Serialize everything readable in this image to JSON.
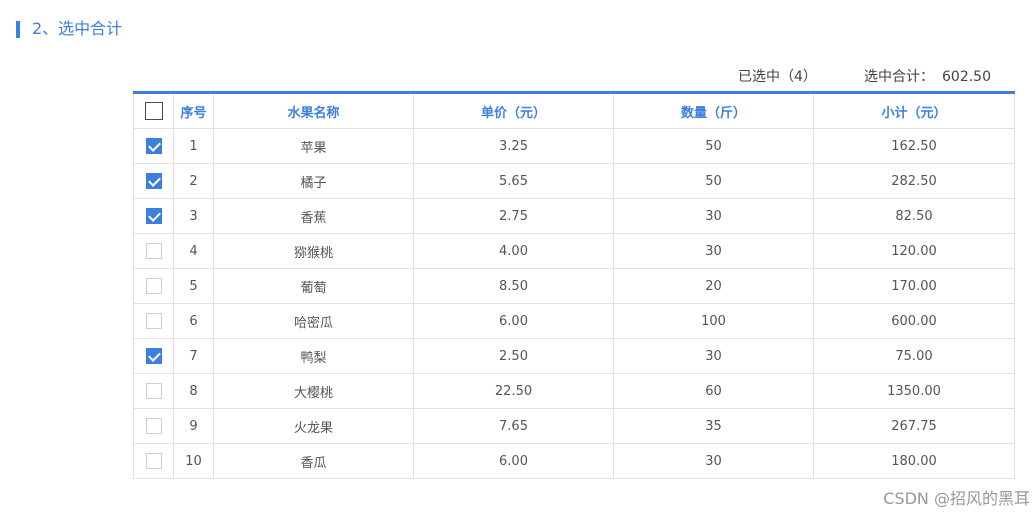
{
  "section": {
    "title": "2、选中合计"
  },
  "summary": {
    "selected_label": "已选中（4）",
    "total_label": "选中合计：",
    "total_value": "602.50"
  },
  "table": {
    "headers": {
      "index": "序号",
      "name": "水果名称",
      "price": "单价（元）",
      "qty": "数量（斤）",
      "subtotal": "小计（元）"
    },
    "select_all_checked": false,
    "rows": [
      {
        "checked": true,
        "index": "1",
        "name": "苹果",
        "price": "3.25",
        "qty": "50",
        "subtotal": "162.50"
      },
      {
        "checked": true,
        "index": "2",
        "name": "橘子",
        "price": "5.65",
        "qty": "50",
        "subtotal": "282.50"
      },
      {
        "checked": true,
        "index": "3",
        "name": "香蕉",
        "price": "2.75",
        "qty": "30",
        "subtotal": "82.50"
      },
      {
        "checked": false,
        "index": "4",
        "name": "猕猴桃",
        "price": "4.00",
        "qty": "30",
        "subtotal": "120.00"
      },
      {
        "checked": false,
        "index": "5",
        "name": "葡萄",
        "price": "8.50",
        "qty": "20",
        "subtotal": "170.00"
      },
      {
        "checked": false,
        "index": "6",
        "name": "哈密瓜",
        "price": "6.00",
        "qty": "100",
        "subtotal": "600.00"
      },
      {
        "checked": true,
        "index": "7",
        "name": "鸭梨",
        "price": "2.50",
        "qty": "30",
        "subtotal": "75.00"
      },
      {
        "checked": false,
        "index": "8",
        "name": "大樱桃",
        "price": "22.50",
        "qty": "60",
        "subtotal": "1350.00"
      },
      {
        "checked": false,
        "index": "9",
        "name": "火龙果",
        "price": "7.65",
        "qty": "35",
        "subtotal": "267.75"
      },
      {
        "checked": false,
        "index": "10",
        "name": "香瓜",
        "price": "6.00",
        "qty": "30",
        "subtotal": "180.00"
      }
    ]
  },
  "watermark": "CSDN @招风的黑耳",
  "colors": {
    "accent": "#3d7fe0",
    "border": "#e2e2e2",
    "text": "#555555"
  }
}
